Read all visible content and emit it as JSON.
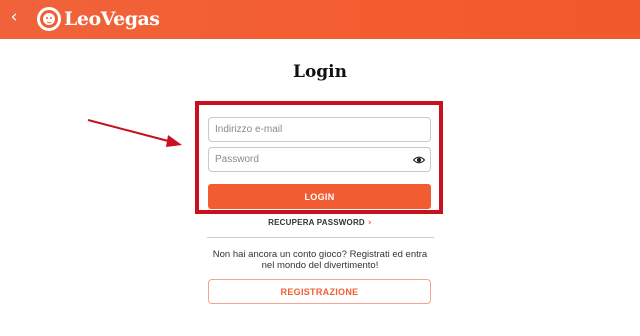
{
  "header": {
    "back_glyph": "‹",
    "brand": "LeoVegas",
    "background_color": "#f25c32"
  },
  "login": {
    "title": "Login",
    "email_placeholder": "Indirizzo e-mail",
    "password_placeholder": "Password",
    "submit_label": "LOGIN",
    "recover_label": "RECUPERA PASSWORD",
    "recover_glyph": "›"
  },
  "signup": {
    "prompt": "Non hai ancora un conto gioco? Registrati ed entra nel mondo del divertimento!",
    "button_label": "REGISTRAZIONE"
  },
  "annotation": {
    "highlight_color": "#c8101f",
    "arrow_color": "#c8101f"
  },
  "icons": {
    "back": "chevron-left-icon",
    "logo": "lion-logo-icon",
    "password_toggle": "eye-icon",
    "recover": "chevron-right-icon"
  }
}
